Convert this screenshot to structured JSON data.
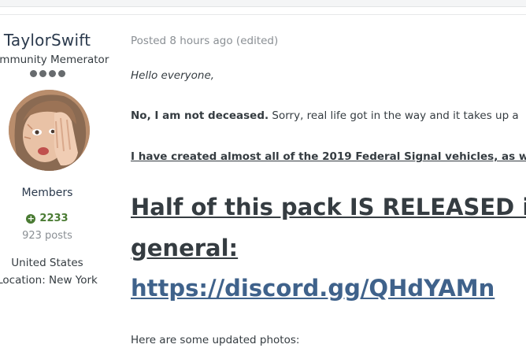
{
  "author": {
    "username": "TaylorSwift",
    "title": "Community Memerator",
    "rank_pips": 4,
    "group": "Members",
    "reputation": "2233",
    "posts": "923 posts",
    "country": "United States",
    "location": "Location: New York"
  },
  "post": {
    "meta": "Posted 8 hours ago (edited)",
    "greeting": "Hello everyone,",
    "p1_bold": "No, I am not deceased.",
    "p1_rest": " Sorry, real life got in the way and it takes up a",
    "p2": "I have created almost all of the 2019 Federal Signal vehicles, as w",
    "headline_line1": "Half of this pack IS RELEASED in",
    "headline_line2": "general:",
    "link": "https://discord.gg/QHdYAMn",
    "p3": "Here are some updated photos:"
  },
  "colors": {
    "username": "#2b3a4d",
    "reputation": "#4a7b33",
    "link": "#3f628b",
    "text": "#353c41",
    "muted": "#8a8f94"
  },
  "icons": {
    "reputation": "plus-circle-icon"
  }
}
